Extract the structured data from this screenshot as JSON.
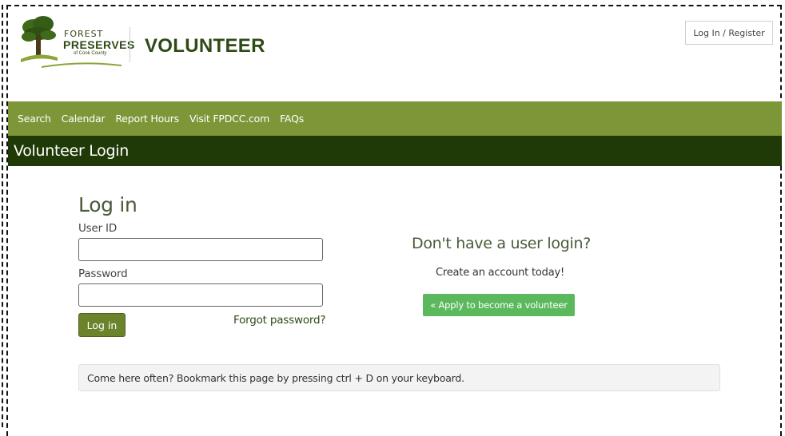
{
  "header": {
    "logo": {
      "line1": "FOREST",
      "line2": "PRESERVES",
      "line3": "of Cook County",
      "icon": "tree-icon"
    },
    "brand_title": "VOLUNTEER",
    "auth_button": "Log In / Register"
  },
  "nav": {
    "items": [
      "Search",
      "Calendar",
      "Report Hours",
      "Visit FPDCC.com",
      "FAQs"
    ]
  },
  "page_title": "Volunteer Login",
  "login": {
    "title": "Log in",
    "user_id_label": "User ID",
    "user_id_value": "",
    "password_label": "Password",
    "password_value": "",
    "submit_label": "Log in",
    "forgot_label": "Forgot password?"
  },
  "signup": {
    "title": "Don't have a user login?",
    "subtitle": "Create an account today!",
    "apply_label": "« Apply to become a volunteer"
  },
  "tip": "Come here often? Bookmark this page by pressing ctrl + D on your keyboard.",
  "colors": {
    "nav_bg": "#7d9637",
    "pagebar_bg": "#1f3a06",
    "brand": "#2e4a15",
    "apply_btn": "#5cb85c",
    "submit_btn": "#6b832b"
  }
}
